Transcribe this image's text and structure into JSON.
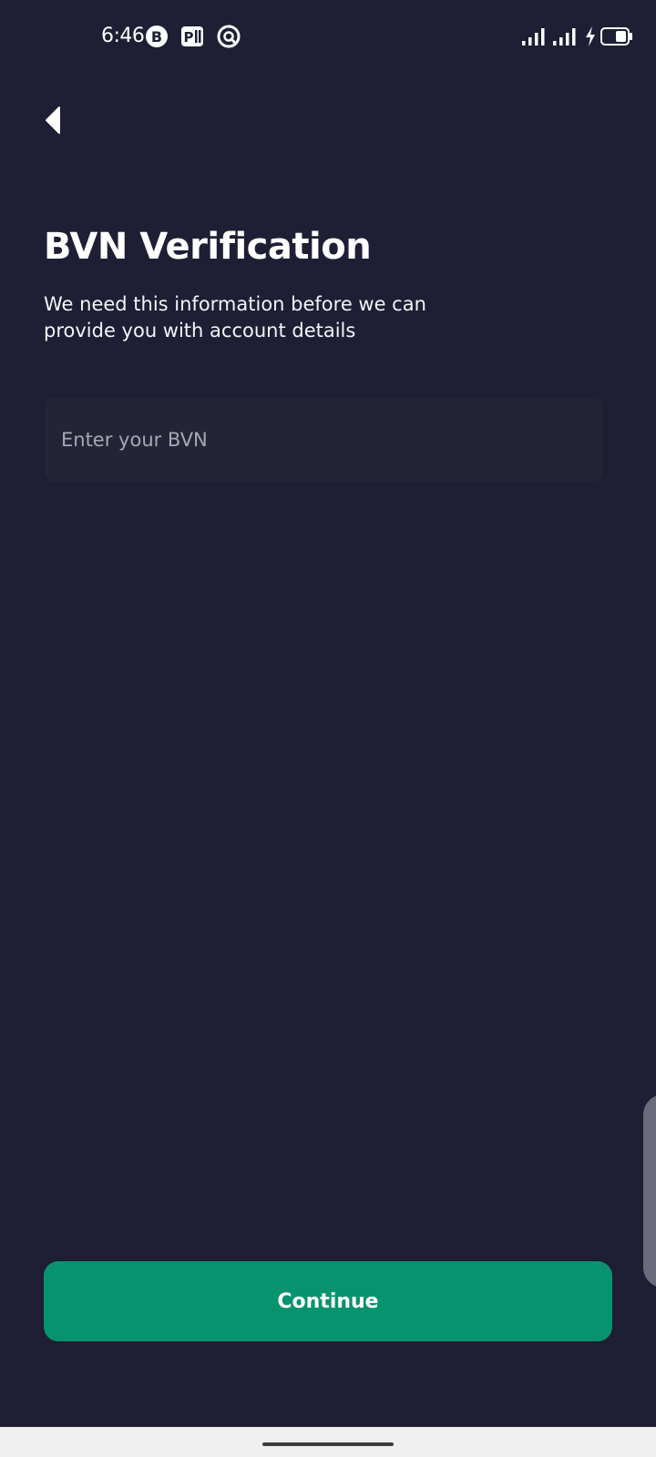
{
  "status_bar": {
    "time": "6:46",
    "app_icons": [
      "b-circle-app-icon",
      "p-app-icon",
      "q-circle-app-icon"
    ],
    "system_icons": [
      "signal-1-icon",
      "signal-2-icon",
      "charging-bolt-icon",
      "battery-icon"
    ]
  },
  "header": {
    "back_icon": "back-arrow-icon"
  },
  "main": {
    "title": "BVN Verification",
    "subtitle": "We need this information before we can provide you with account details",
    "bvn_input": {
      "placeholder": "Enter your BVN",
      "value": ""
    }
  },
  "footer": {
    "continue_label": "Continue"
  },
  "colors": {
    "background": "#1e1e34",
    "input_background": "#242437",
    "accent": "#07936e",
    "text": "#ffffff",
    "placeholder": "#a7a7b4"
  }
}
